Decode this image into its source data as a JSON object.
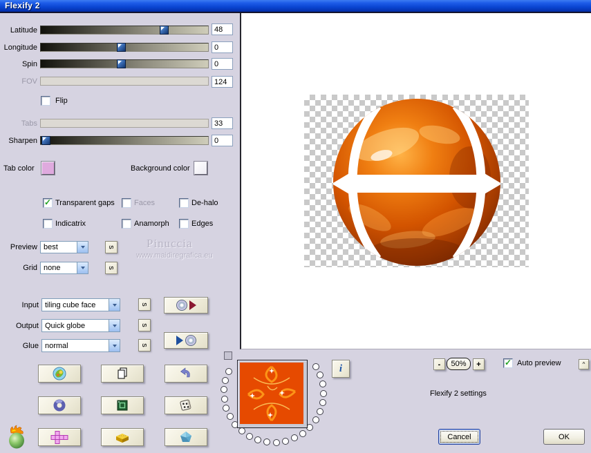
{
  "window": {
    "title": "Flexify 2"
  },
  "sliders": [
    {
      "label": "Latitude",
      "value": "48",
      "disabled": false
    },
    {
      "label": "Longitude",
      "value": "0",
      "disabled": false
    },
    {
      "label": "Spin",
      "value": "0",
      "disabled": false
    },
    {
      "label": "FOV",
      "value": "124",
      "disabled": true
    },
    {
      "label": "Tabs",
      "value": "33",
      "disabled": true
    },
    {
      "label": "Sharpen",
      "value": "0",
      "disabled": false
    }
  ],
  "checkboxes": {
    "flip": {
      "label": "Flip",
      "checked": false
    },
    "transparent_gaps": {
      "label": "Transparent gaps",
      "checked": true
    },
    "faces": {
      "label": "Faces",
      "checked": false,
      "disabled": true
    },
    "dehalo": {
      "label": "De-halo",
      "checked": false
    },
    "indicatrix": {
      "label": "Indicatrix",
      "checked": false
    },
    "anamorph": {
      "label": "Anamorph",
      "checked": false
    },
    "edges": {
      "label": "Edges",
      "checked": false
    },
    "auto_preview": {
      "label": "Auto preview",
      "checked": true
    }
  },
  "color_pickers": {
    "tab_color": {
      "label": "Tab color",
      "value": "#dfaade"
    },
    "background_color": {
      "label": "Background color",
      "value": "#ffffff"
    }
  },
  "dropdowns": {
    "preview": {
      "label": "Preview",
      "value": "best"
    },
    "grid": {
      "label": "Grid",
      "value": "none"
    },
    "input": {
      "label": "Input",
      "value": "tiling cube face"
    },
    "output": {
      "label": "Output",
      "value": "Quick globe"
    },
    "glue": {
      "label": "Glue",
      "value": "normal"
    }
  },
  "buttons": {
    "s_label": "s",
    "minus": "-",
    "plus": "+",
    "caret": "^",
    "info": "i",
    "cancel": "Cancel",
    "ok": "OK"
  },
  "icon_grid": [
    {
      "icon": "flaming-pear-logo-icon"
    },
    {
      "icon": "copy-pages-icon"
    },
    {
      "icon": "undo-arrow-icon"
    },
    {
      "icon": "torus-icon"
    },
    {
      "icon": "green-frame-chip-icon"
    },
    {
      "icon": "dice-icon"
    },
    {
      "icon": "cube-net-icon"
    },
    {
      "icon": "lego-brick-icon"
    },
    {
      "icon": "polyhedron-icon"
    }
  ],
  "settings_io": [
    {
      "icon": "disc-then-red-play-icon"
    },
    {
      "icon": "blue-play-then-disc-icon"
    }
  ],
  "zoom": {
    "percent": "50%"
  },
  "status": {
    "settings_text": "Flexify 2 settings"
  },
  "watermark": {
    "name": "Pinuccia",
    "url": "www.maidiregrafica.eu"
  },
  "preview_colors": {
    "sphere_main": "#d35400",
    "checker_gray": "#c9c9c9",
    "gap": "#ffffff"
  }
}
